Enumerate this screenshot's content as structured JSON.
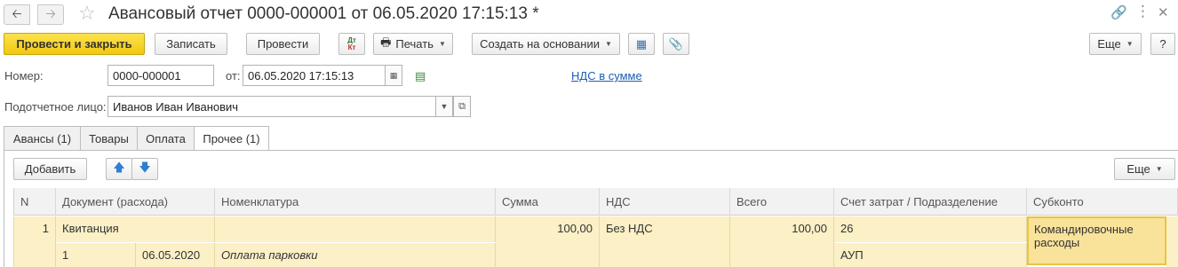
{
  "window": {
    "title": "Авансовый отчет 0000-000001 от 06.05.2020 17:15:13 *"
  },
  "toolbar": {
    "post_close": "Провести и закрыть",
    "save": "Записать",
    "post": "Провести",
    "dt_kt": "Дт Кт",
    "print": "Печать",
    "create_based": "Создать на основании",
    "more": "Еще",
    "help": "?"
  },
  "form": {
    "number_label": "Номер:",
    "number_value": "0000-000001",
    "date_label": "от:",
    "date_value": "06.05.2020 17:15:13",
    "vat_link": "НДС в сумме",
    "person_label": "Подотчетное лицо:",
    "person_value": "Иванов Иван Иванович"
  },
  "tabs": [
    {
      "label": "Авансы (1)",
      "active": false
    },
    {
      "label": "Товары",
      "active": false
    },
    {
      "label": "Оплата",
      "active": false
    },
    {
      "label": "Прочее (1)",
      "active": true
    }
  ],
  "table_toolbar": {
    "add": "Добавить",
    "more": "Еще"
  },
  "table": {
    "columns": [
      "N",
      "Документ (расхода)",
      "Номенклатура",
      "Сумма",
      "НДС",
      "Всего",
      "Счет затрат / Подразделение",
      "Субконто"
    ],
    "row": {
      "n": "1",
      "doc_type": "Квитанция",
      "doc_number": "1",
      "doc_date": "06.05.2020",
      "nomenclature": "Оплата парковки",
      "sum": "100,00",
      "vat": "Без НДС",
      "total": "100,00",
      "account": "26",
      "department": "АУП",
      "subconto": "Командировочные расходы"
    }
  }
}
